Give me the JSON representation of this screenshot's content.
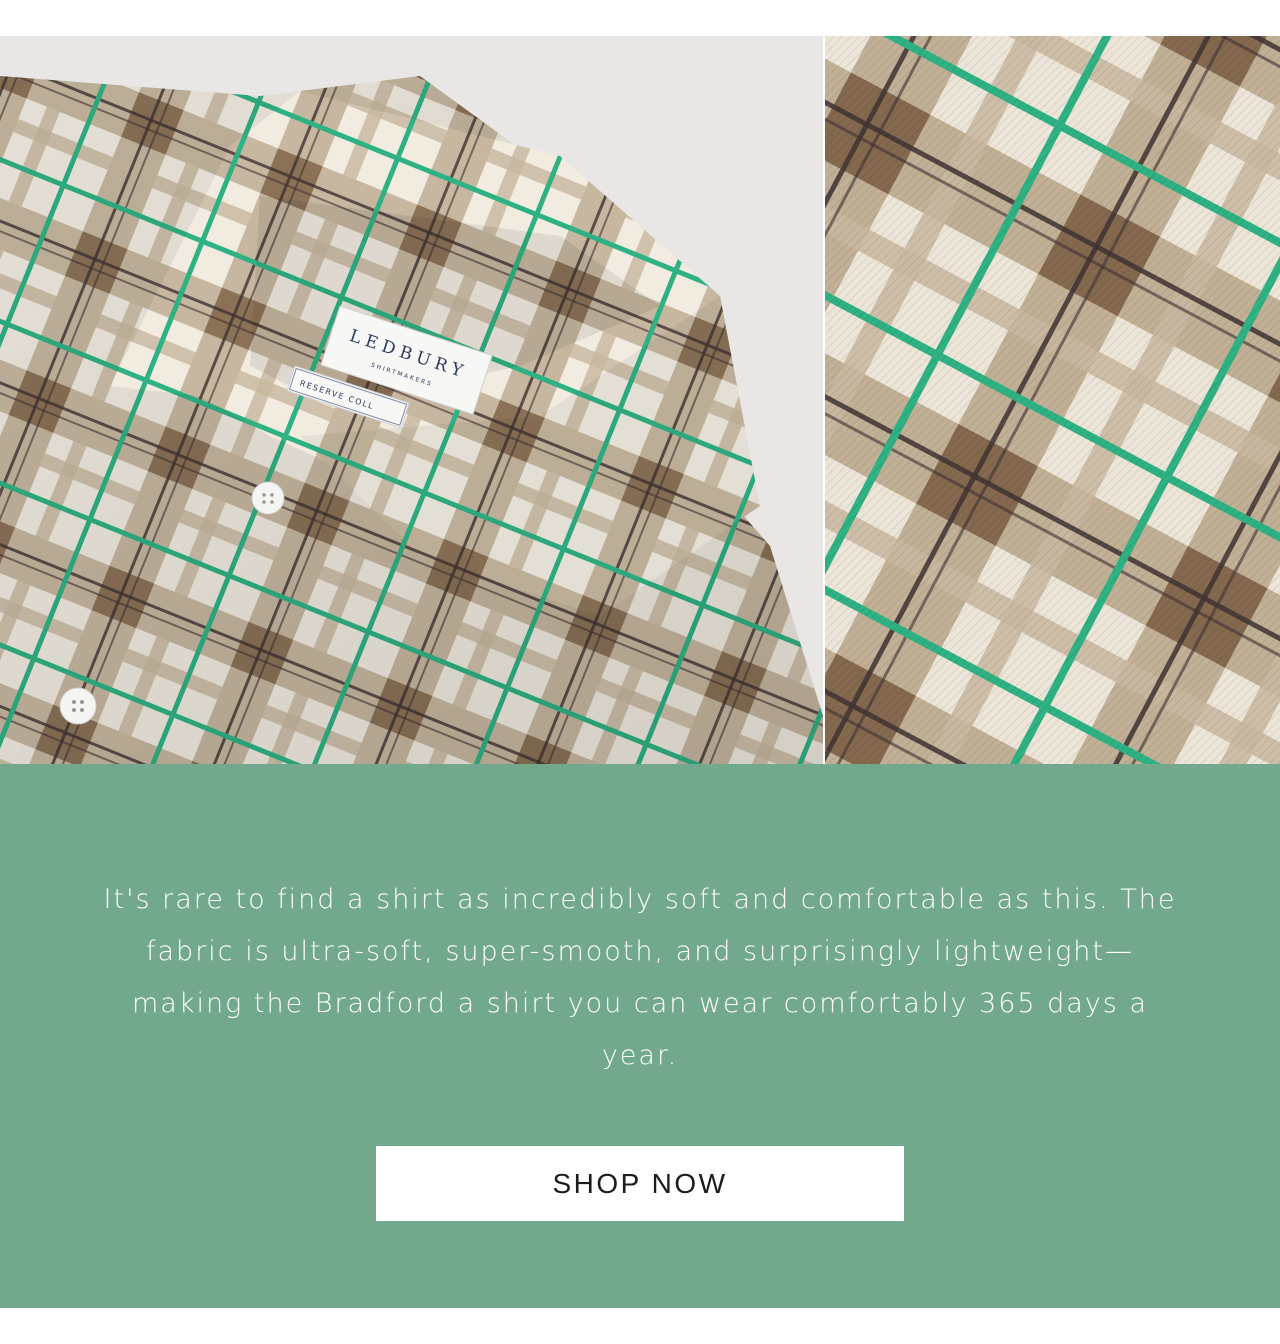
{
  "hero": {
    "shirt_photo": {
      "label_brand": "LEDBURY",
      "label_sub": "SHIRTMAKERS",
      "label_tag": "RESERVE COLL"
    },
    "swatch_photo": {}
  },
  "promo": {
    "body_text": "It's rare to find a shirt as incredibly soft and comfortable as this. The fabric is ultra-soft, super-smooth, and surprisingly lightweight—making the Bradford a shirt you can wear comfortably 365 days a year.",
    "button_label": "SHOP NOW"
  },
  "colors": {
    "panel_green": "#72a98c",
    "plaid_tan": "#a88f72",
    "plaid_cream": "#f1ebe0",
    "plaid_stripe_green": "#2fb283",
    "plaid_stripe_dark": "#3f3232"
  }
}
